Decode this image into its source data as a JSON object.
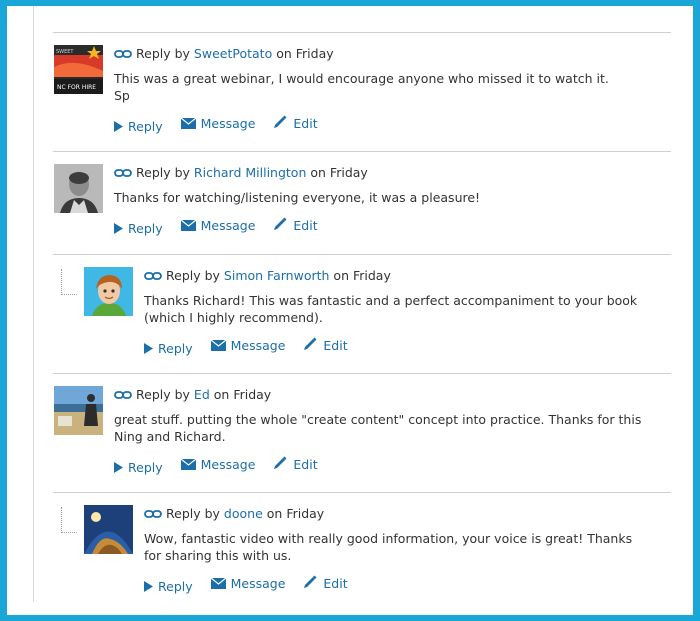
{
  "labels": {
    "reply_by": "Reply by",
    "on": "on",
    "reply": "Reply",
    "message": "Message",
    "edit": "Edit"
  },
  "comments": [
    {
      "author": "SweetPotato",
      "day": "Friday",
      "text_lines": [
        "This was a great webinar, I would encourage anyone who missed it to watch it.",
        "Sp"
      ],
      "avatar_badge": "NC FOR HIRE",
      "avatar_small": "SWEET"
    },
    {
      "author": "Richard Millington",
      "day": "Friday",
      "text_lines": [
        "Thanks for watching/listening everyone, it was a pleasure!"
      ]
    },
    {
      "author": "Simon Farnworth",
      "day": "Friday",
      "text_lines": [
        "Thanks Richard! This was fantastic and a perfect accompaniment to your book",
        "(which I highly recommend)."
      ]
    },
    {
      "author": "Ed",
      "day": "Friday",
      "text_lines": [
        "great stuff. putting the whole \"create content\" concept into practice. Thanks for this",
        "Ning and Richard."
      ]
    },
    {
      "author": "doone",
      "day": "Friday",
      "text_lines": [
        "Wow, fantastic video with really good information,  your voice is great!  Thanks",
        "for sharing this with us."
      ]
    }
  ],
  "colors": {
    "frame_border": "#1aa6d6",
    "link": "#1b6ea8",
    "divider": "#cfcfcf"
  }
}
